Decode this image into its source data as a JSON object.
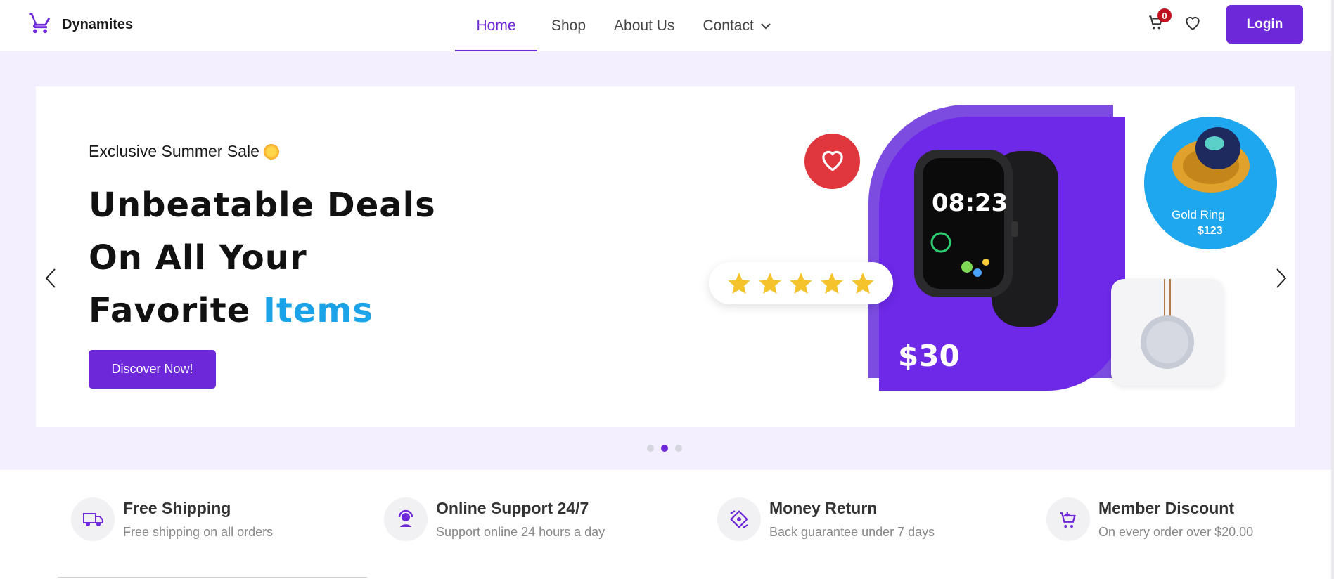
{
  "brand": {
    "name": "Dynamites",
    "icon": "cart-icon"
  },
  "nav": {
    "items": [
      {
        "label": "Home",
        "active": true
      },
      {
        "label": "Shop",
        "active": false
      },
      {
        "label": "About Us",
        "active": false
      },
      {
        "label": "Contact",
        "active": false,
        "has_dropdown": true
      }
    ]
  },
  "header": {
    "cart_count": "0",
    "login_label": "Login"
  },
  "hero": {
    "subtitle": "Exclusive Summer Sale",
    "headline_line1": "Unbeatable Deals",
    "headline_line2": "On All Your",
    "headline_line3": "Favorite",
    "headline_accent": "Items",
    "cta_label": "Discover Now!",
    "watch_price": "$30",
    "ring_label": "Gold Ring",
    "ring_price": "$123",
    "rating_stars": 5,
    "active_slide": 2,
    "slide_count": 3
  },
  "features": [
    {
      "icon": "truck-icon",
      "title": "Free Shipping",
      "desc": "Free shipping on all orders"
    },
    {
      "icon": "support-icon",
      "title": "Online Support 24/7",
      "desc": "Support online 24 hours a day"
    },
    {
      "icon": "money-return-icon",
      "title": "Money Return",
      "desc": "Back guarantee under 7 days"
    },
    {
      "icon": "cart-discount-icon",
      "title": "Member Discount",
      "desc": "On every order over $20.00"
    }
  ],
  "colors": {
    "accent": "#6d28d9",
    "accent_blue": "#1aa3e8",
    "heart_red": "#e0363d",
    "band": "#f3effe"
  }
}
